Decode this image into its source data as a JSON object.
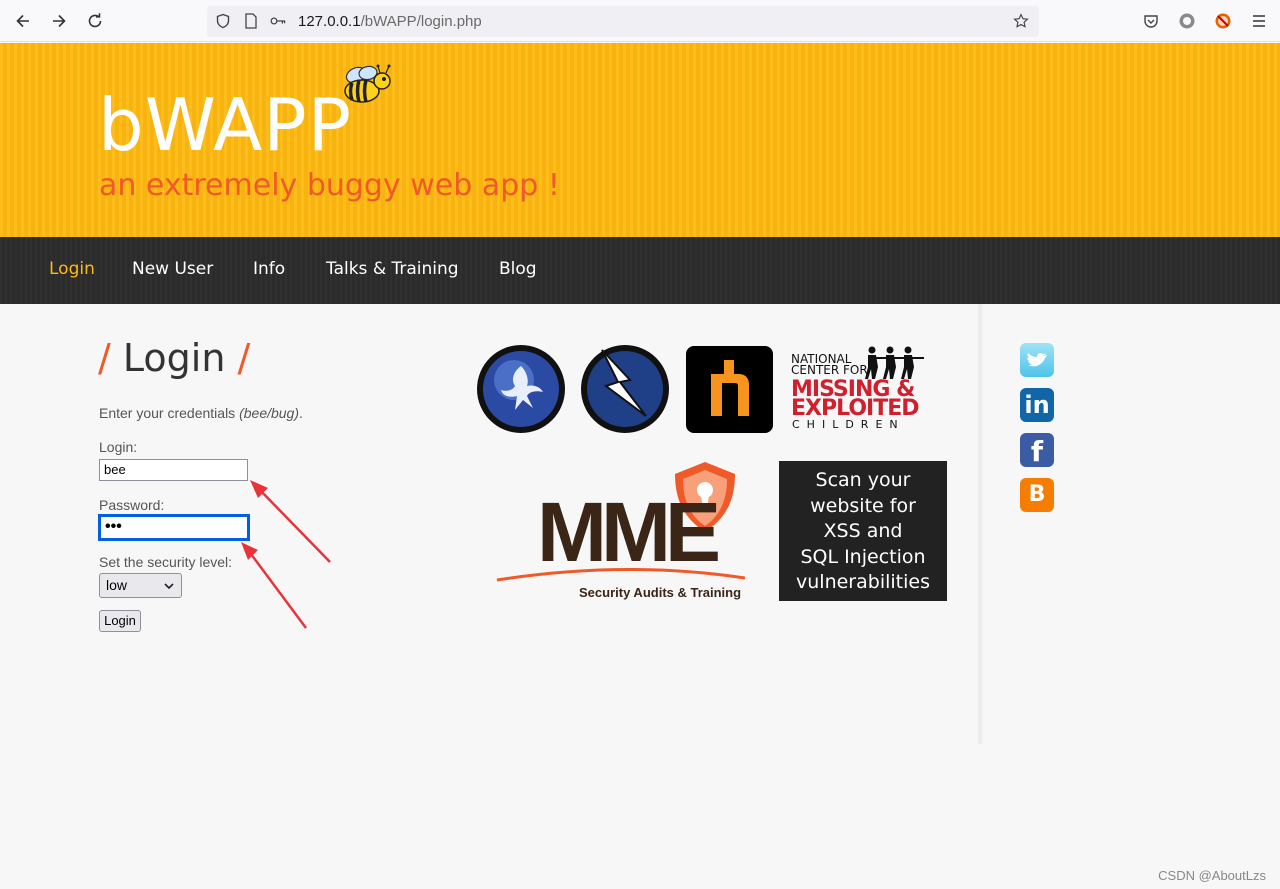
{
  "browser": {
    "url_host": "127.0.0.1",
    "url_path": "/bWAPP/login.php"
  },
  "header": {
    "logo": "bWAPP",
    "tagline": "an extremely buggy web app !"
  },
  "menu": {
    "items": [
      {
        "label": "Login",
        "active": true
      },
      {
        "label": "New User",
        "active": false
      },
      {
        "label": "Info",
        "active": false
      },
      {
        "label": "Talks & Training",
        "active": false
      },
      {
        "label": "Blog",
        "active": false
      }
    ]
  },
  "login": {
    "title": "Login",
    "slash": "/",
    "intro": "Enter your credentials ",
    "intro_hint": "(bee/bug)",
    "intro_end": ".",
    "login_label": "Login:",
    "login_value": "bee",
    "password_label": "Password:",
    "password_mask": "•••",
    "security_label": "Set the security level:",
    "security_value": "low",
    "submit_label": "Login"
  },
  "ads": {
    "mme_word": "MME",
    "mme_sub": "Security Audits & Training",
    "ncmec_line1": "NATIONAL",
    "ncmec_line2": "CENTER FOR",
    "ncmec_line3": "MISSING &",
    "ncmec_line4": "EXPLOITED",
    "ncmec_line5": "CHILDREN",
    "scan_lines": [
      "Scan your",
      "website for",
      "XSS and",
      "SQL Injection",
      "vulnerabilities"
    ]
  },
  "social": {
    "icons": [
      "twitter-icon",
      "linkedin-icon",
      "facebook-icon",
      "blogger-icon"
    ],
    "linkedin_text": "in",
    "facebook_text": "f",
    "blogger_text": "B"
  },
  "watermark": "CSDN @AboutLzs",
  "colors": {
    "header_bg": "#ffb90f",
    "accent_orange": "#f05a28",
    "menu_bg": "#2d2d2d",
    "focus_blue": "#0060df",
    "annotation_red": "#e8333a"
  }
}
